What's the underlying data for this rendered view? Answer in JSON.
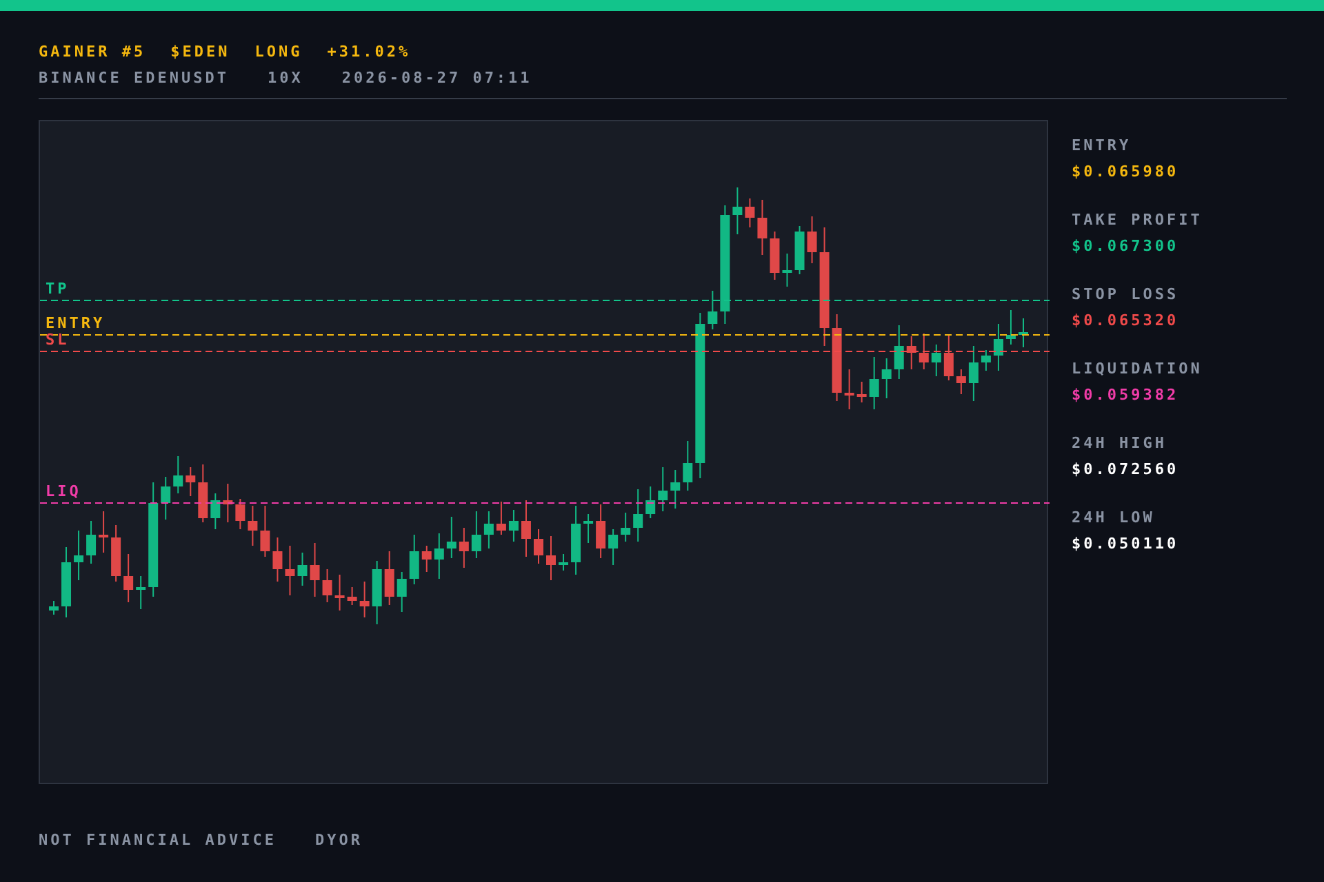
{
  "header": {
    "title_parts": [
      "GAINER #5",
      "$EDEN",
      "LONG",
      "+31.02%"
    ],
    "meta_parts": [
      "BINANCE EDENUSDT",
      "10X",
      "2026-08-27 07:11"
    ]
  },
  "chart": {
    "levels": [
      {
        "label": "TP",
        "color": "#12c48b"
      },
      {
        "label": "ENTRY",
        "color": "#f5b80f"
      },
      {
        "label": "SL",
        "color": "#f04a4a"
      },
      {
        "label": "LIQ",
        "color": "#f03ca8"
      }
    ]
  },
  "stats": [
    {
      "label": "ENTRY",
      "value": "$0.065980",
      "color": "#f5b80f"
    },
    {
      "label": "TAKE PROFIT",
      "value": "$0.067300",
      "color": "#12c48b"
    },
    {
      "label": "STOP LOSS",
      "value": "$0.065320",
      "color": "#f04a4a"
    },
    {
      "label": "LIQUIDATION",
      "value": "$0.059382",
      "color": "#f03ca8"
    },
    {
      "label": "24H HIGH",
      "value": "$0.072560",
      "color": "#ffffff"
    },
    {
      "label": "24H LOW",
      "value": "$0.050110",
      "color": "#ffffff"
    }
  ],
  "footer": [
    "NOT FINANCIAL ADVICE",
    "DYOR"
  ]
}
